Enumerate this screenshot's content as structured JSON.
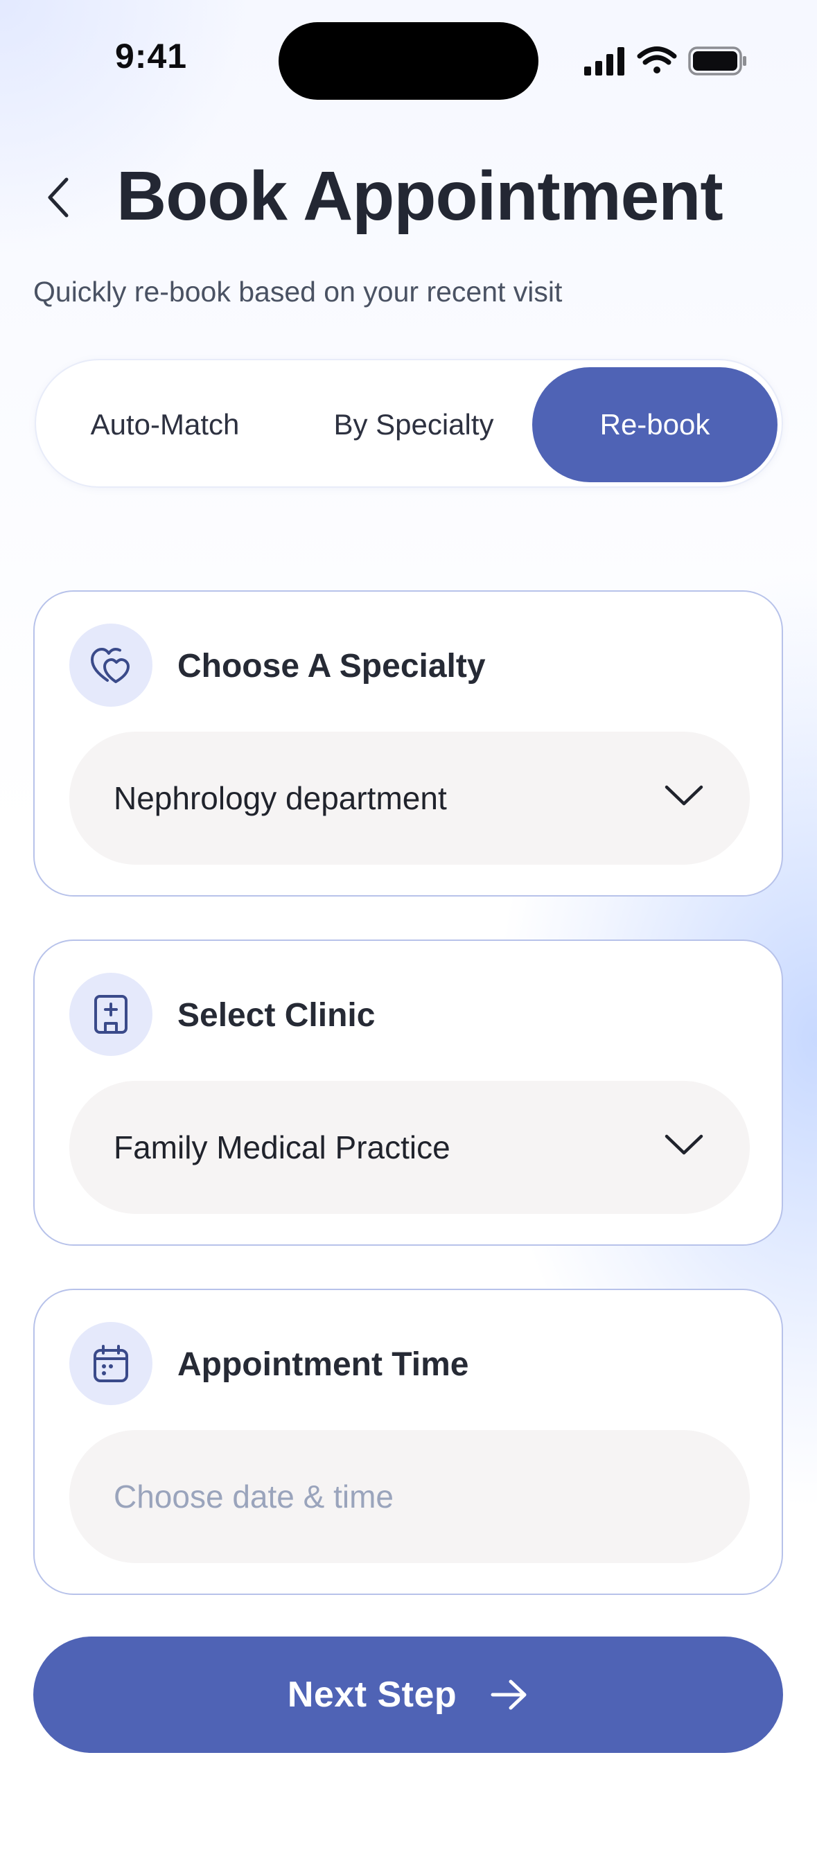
{
  "status_bar": {
    "time": "9:41"
  },
  "header": {
    "title": "Book Appointment",
    "subtitle": "Quickly re-book based on your recent visit",
    "back_icon": "chevron-left-icon"
  },
  "tabs": [
    {
      "label": "Auto-Match",
      "active": false
    },
    {
      "label": "By Specialty",
      "active": false
    },
    {
      "label": "Re-book",
      "active": true
    }
  ],
  "cards": {
    "specialty": {
      "title": "Choose A Specialty",
      "icon": "hearts-icon",
      "value": "Nephrology department"
    },
    "clinic": {
      "title": "Select Clinic",
      "icon": "hospital-building-icon",
      "value": "Family Medical Practice"
    },
    "time": {
      "title": "Appointment Time",
      "icon": "calendar-icon",
      "placeholder": "Choose date & time"
    }
  },
  "next_button": {
    "label": "Next Step",
    "icon": "arrow-right-icon"
  },
  "colors": {
    "accent": "#4f63b5",
    "icon_bg": "#e5e9fb",
    "field_bg": "#f6f4f4",
    "card_border": "#b7c2ea",
    "icon_stroke": "#3a4a8a"
  }
}
